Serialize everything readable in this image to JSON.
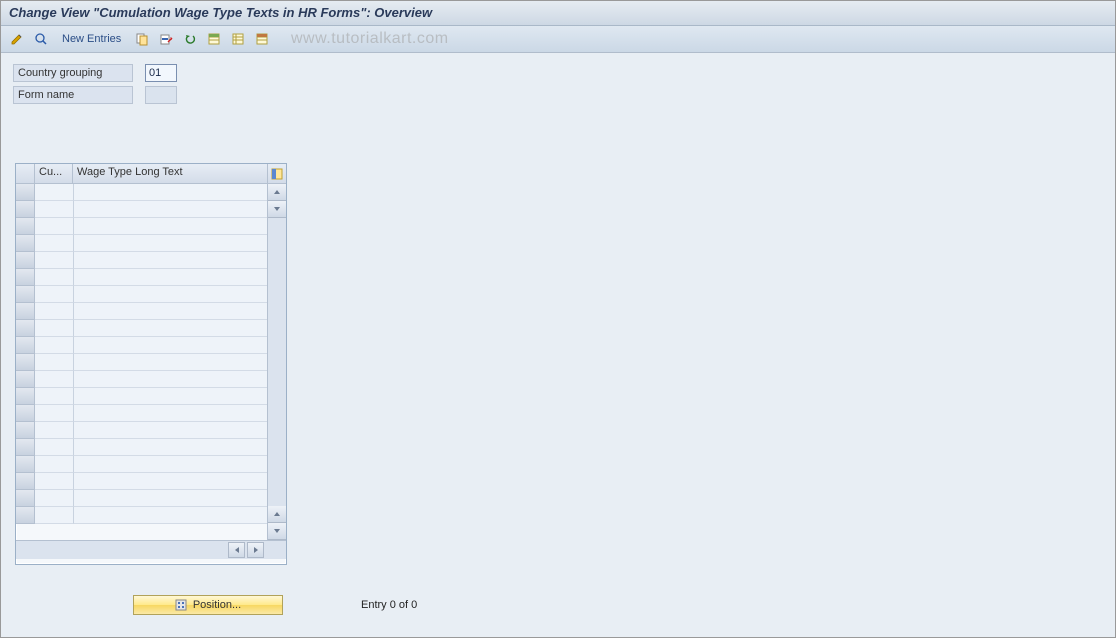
{
  "title": "Change View \"Cumulation Wage Type Texts in HR Forms\": Overview",
  "toolbar": {
    "new_entries_label": "New Entries"
  },
  "watermark": "www.tutorialkart.com",
  "form": {
    "country_grouping_label": "Country grouping",
    "country_grouping_value": "01",
    "form_name_label": "Form name",
    "form_name_value": ""
  },
  "table": {
    "col_cu": "Cu...",
    "col_long": "Wage Type Long Text",
    "rows": 20
  },
  "footer": {
    "position_label": "Position...",
    "entry_text": "Entry 0 of 0"
  }
}
